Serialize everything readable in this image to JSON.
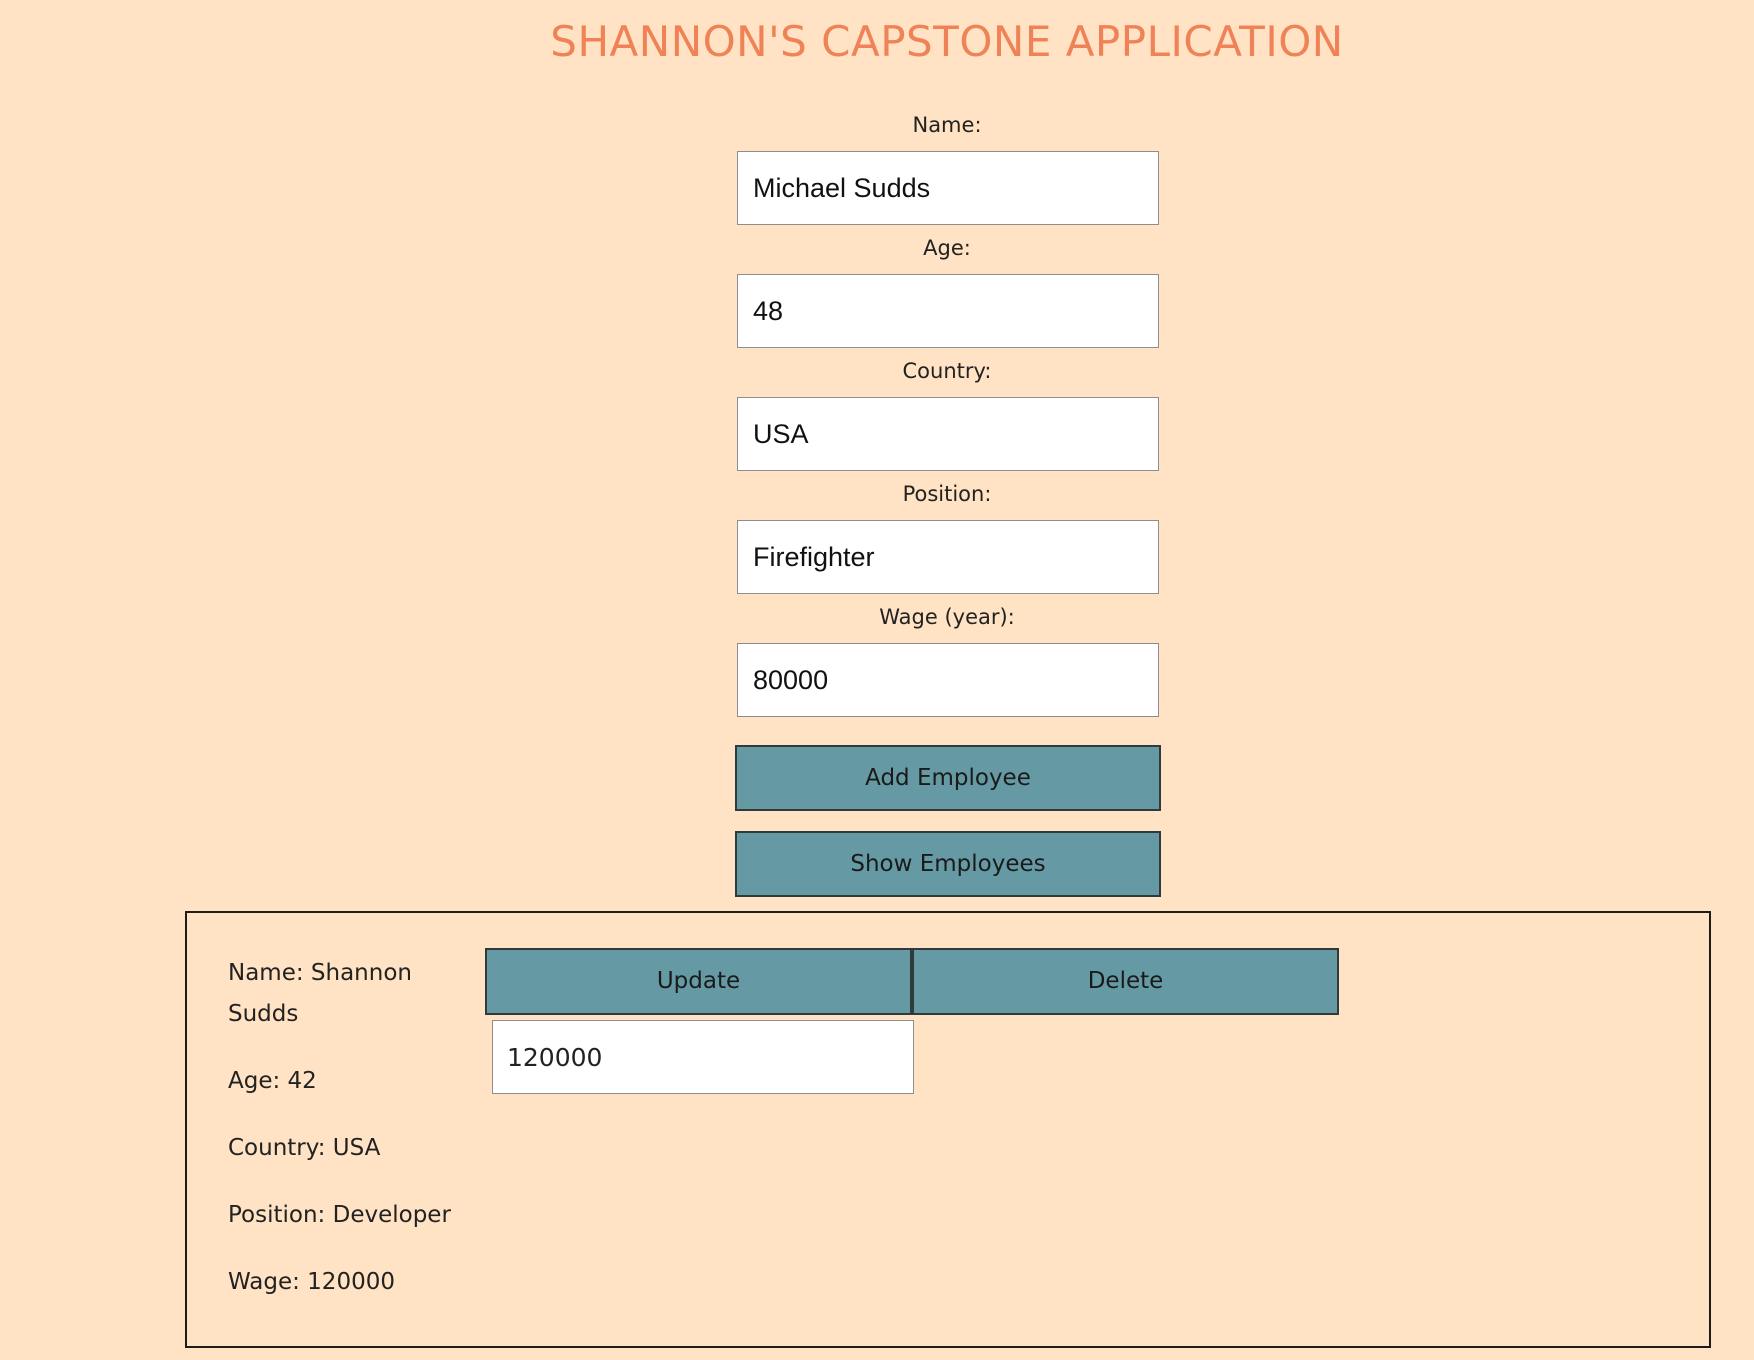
{
  "app": {
    "title": "SHANNON'S CAPSTONE APPLICATION"
  },
  "form": {
    "name": {
      "label": "Name:",
      "value": "Michael Sudds"
    },
    "age": {
      "label": "Age:",
      "value": "48"
    },
    "country": {
      "label": "Country:",
      "value": "USA"
    },
    "position": {
      "label": "Position:",
      "value": "Firefighter"
    },
    "wage": {
      "label": "Wage (year):",
      "value": "80000"
    },
    "add_button": "Add Employee",
    "show_button": "Show Employees"
  },
  "employees": [
    {
      "name": "Name: Shannon Sudds",
      "age": "Age: 42",
      "country": "Country: USA",
      "position": "Position: Developer",
      "wage": "Wage: 120000",
      "update_button": "Update",
      "delete_button": "Delete",
      "new_wage_value": "120000"
    }
  ],
  "colors": {
    "background": "#ffe3c4",
    "title": "#f08258",
    "button": "#659aa4"
  }
}
